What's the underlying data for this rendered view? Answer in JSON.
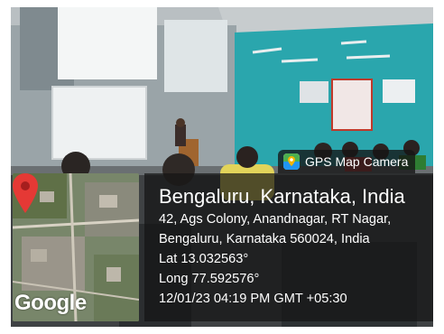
{
  "overlay": {
    "app_name": "GPS Map Camera",
    "map_logo": "Google",
    "location_title": "Bengaluru, Karnataka, India",
    "address_line_1": "42, Ags Colony, Anandnagar, RT Nagar,",
    "address_line_2": "Bengaluru, Karnataka 560024, India",
    "latitude": "Lat 13.032563°",
    "longitude": "Long 77.592576°",
    "datetime": "12/01/23 04:19 PM GMT +05:30"
  },
  "icons": {
    "app": "gps-map-camera-app-icon",
    "pin": "map-pin-icon"
  },
  "colors": {
    "teal_wall": "#2aa6ad",
    "pin_red": "#e53935",
    "overlay_bg": "#141414"
  }
}
